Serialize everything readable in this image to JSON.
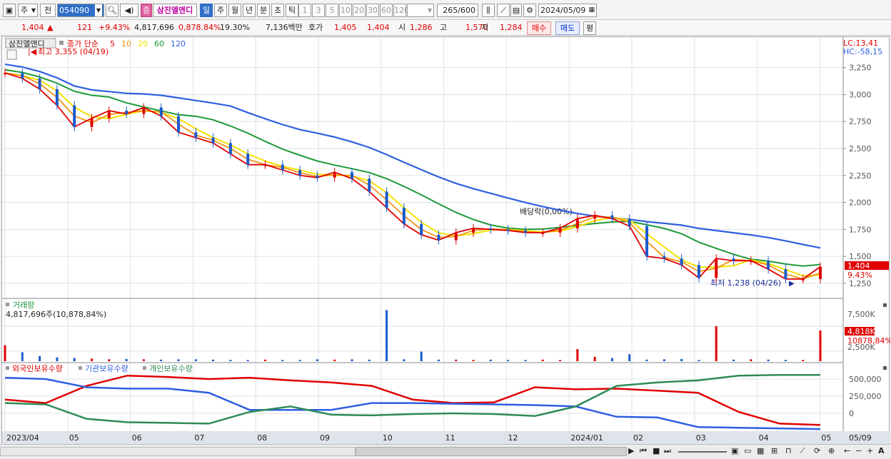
{
  "toolbar": {
    "market": "주",
    "category": "전",
    "code": "054090",
    "stock_badge": "증",
    "stock_name": "삼진엘앤디",
    "periods": [
      "일",
      "주",
      "월",
      "년",
      "분",
      "초",
      "틱"
    ],
    "selected_period": "일",
    "intervals": [
      "1",
      "3",
      "5",
      "10",
      "20",
      "30",
      "60",
      "120"
    ],
    "count": "265",
    "count_total": "/600",
    "date": "2024/05/09"
  },
  "quote": {
    "price": "1,404",
    "change_arrow": "▲",
    "change": "121",
    "change_pct": "+9.43%",
    "volume": "4,817,696",
    "volume_ratio": "0,878.84%",
    "turnover": "19.30%",
    "amount": "7,136백만",
    "bid_label": "호가",
    "bid1": "1,405",
    "bid2": "1,404",
    "open_label": "시",
    "open": "1,286",
    "high_label": "고",
    "high": "1,570",
    "low_label": "저",
    "low": "1,284",
    "buy": "매수",
    "sell": "매도",
    "avg": "평"
  },
  "price_panel": {
    "name": "삼진엘앤디",
    "legend_prefix": "종가 단순",
    "ma": [
      "5",
      "10",
      "20",
      "60",
      "120"
    ],
    "ma_colors": [
      "#e00000",
      "#f08a00",
      "#f5e100",
      "#1e9a3a",
      "#2f5fe0"
    ],
    "lc": "LC:13,41",
    "hc": "HC:-58,15",
    "high_note": "최고 3,355 (04/19)",
    "low_note": "최저 1,238 (04/26)",
    "dividend_note": "배당락(0,00%)",
    "y_ticks": [
      "3,250",
      "3,000",
      "2,750",
      "2,500",
      "2,250",
      "2,000",
      "1,750",
      "1,500",
      "1,250"
    ],
    "price_tag": "1,404",
    "pct_tag": "9.43%"
  },
  "volume_panel": {
    "title": "거래량",
    "info": "4,817,696주(10,878,84%)",
    "y_ticks": [
      "7,500K",
      "2,500K"
    ],
    "vol_tag": "4,818K",
    "ratio_tag": "10878,84%"
  },
  "holder_panel": {
    "legend": [
      {
        "label": "외국인보유수량",
        "color": "#e00000"
      },
      {
        "label": "기관보유수량",
        "color": "#2f5fe0"
      },
      {
        "label": "개인보유수량",
        "color": "#2e8b57"
      }
    ],
    "y_ticks": [
      "500,000",
      "250,000",
      "0"
    ]
  },
  "x_axis": {
    "labels": [
      "2023/04",
      "05",
      "06",
      "07",
      "08",
      "09",
      "10",
      "11",
      "12",
      "2024/01",
      "02",
      "03",
      "04",
      "05"
    ],
    "right_label": "05/09"
  },
  "chart_data": {
    "type": "candlestick",
    "y_range": [
      1150,
      3400
    ],
    "price_series": [
      3200,
      3150,
      3050,
      2900,
      2700,
      2780,
      2850,
      2820,
      2880,
      2800,
      2650,
      2600,
      2550,
      2450,
      2350,
      2350,
      2300,
      2250,
      2230,
      2280,
      2220,
      2100,
      1950,
      1800,
      1700,
      1650,
      1720,
      1760,
      1750,
      1740,
      1720,
      1720,
      1760,
      1850,
      1880,
      1850,
      1780,
      1500,
      1480,
      1420,
      1300,
      1480,
      1460,
      1460,
      1380,
      1290,
      1290,
      1404
    ],
    "volume_max_k": 8500,
    "volume_series_k": [
      2500,
      1400,
      800,
      600,
      500,
      400,
      300,
      350,
      300,
      250,
      300,
      300,
      250,
      200,
      200,
      250,
      200,
      200,
      300,
      250,
      300,
      250,
      8000,
      300,
      1500,
      250,
      250,
      200,
      250,
      200,
      200,
      250,
      200,
      1900,
      700,
      500,
      1100,
      250,
      300,
      350,
      200,
      5500,
      250,
      300,
      250,
      200,
      200,
      4818
    ],
    "series": [
      {
        "name": "외국인보유수량",
        "values": [
          200,
          150,
          400,
          550,
          530,
          500,
          520,
          480,
          450,
          400,
          200,
          150,
          160,
          380,
          350,
          360,
          330,
          300,
          20,
          -150,
          -170
        ]
      },
      {
        "name": "기관보유수량",
        "values": [
          520,
          500,
          380,
          360,
          360,
          300,
          50,
          50,
          50,
          150,
          150,
          140,
          130,
          120,
          100,
          -50,
          -60,
          -200,
          -210,
          -220,
          -230
        ]
      },
      {
        "name": "개인보유수량",
        "values": [
          150,
          130,
          -80,
          -130,
          -140,
          -150,
          20,
          100,
          -20,
          -30,
          -10,
          0,
          -10,
          -40,
          100,
          400,
          450,
          480,
          550,
          560,
          560
        ]
      }
    ]
  }
}
